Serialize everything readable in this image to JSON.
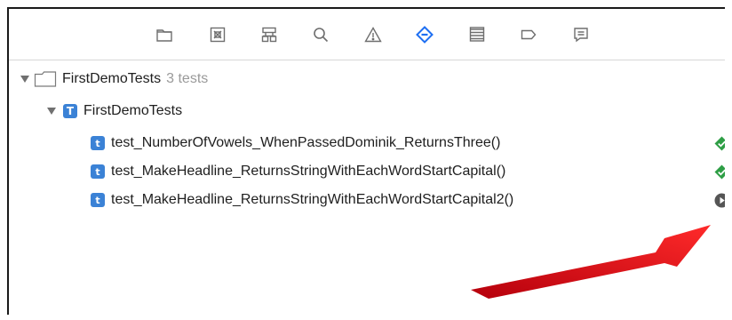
{
  "toolbar": {
    "icons": [
      {
        "name": "project-navigator-icon",
        "active": false
      },
      {
        "name": "source-control-navigator-icon",
        "active": false
      },
      {
        "name": "symbol-navigator-icon",
        "active": false
      },
      {
        "name": "find-navigator-icon",
        "active": false
      },
      {
        "name": "issue-navigator-icon",
        "active": false
      },
      {
        "name": "test-navigator-icon",
        "active": true
      },
      {
        "name": "debug-navigator-icon",
        "active": false
      },
      {
        "name": "breakpoint-navigator-icon",
        "active": false
      },
      {
        "name": "report-navigator-icon",
        "active": false
      }
    ],
    "accent": "#1e6ff2"
  },
  "tree": {
    "bundle": {
      "name": "FirstDemoTests",
      "count": "3 tests"
    },
    "test_class": {
      "badge": "T",
      "name": "FirstDemoTests"
    },
    "tests": [
      {
        "badge": "t",
        "name": "test_NumberOfVowels_WhenPassedDominik_ReturnsThree()",
        "status": "passed"
      },
      {
        "badge": "t",
        "name": "test_MakeHeadline_ReturnsStringWithEachWordStartCapital()",
        "status": "passed"
      },
      {
        "badge": "t",
        "name": "test_MakeHeadline_ReturnsStringWithEachWordStartCapital2()",
        "status": "run"
      }
    ]
  },
  "colors": {
    "badge_blue": "#3b82d6",
    "passed_green": "#2e9e45",
    "run_gray": "#555555",
    "annotation_red": "#e0141e"
  }
}
